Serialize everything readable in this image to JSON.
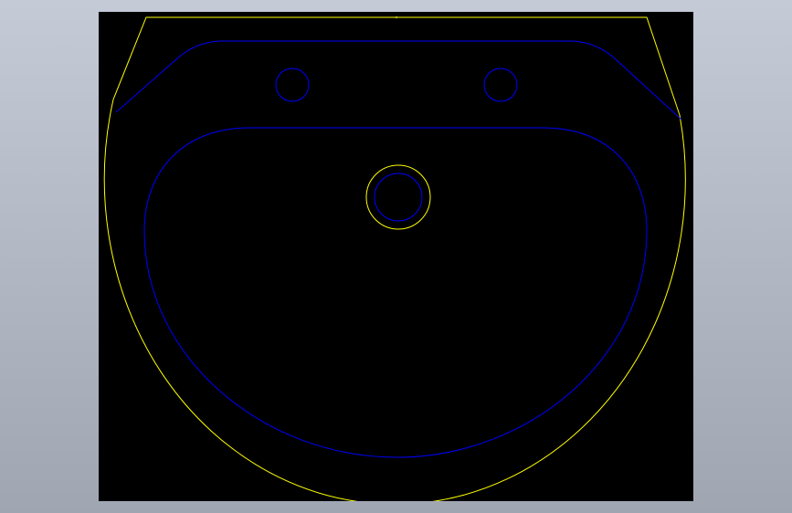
{
  "diagram": {
    "subject": "washbasin-top-view",
    "background_color": "#000000",
    "viewport_color": "#b4bac6",
    "layers": [
      {
        "name": "outline",
        "color": "#ffff00"
      },
      {
        "name": "detail",
        "color": "#0000ff"
      }
    ]
  }
}
